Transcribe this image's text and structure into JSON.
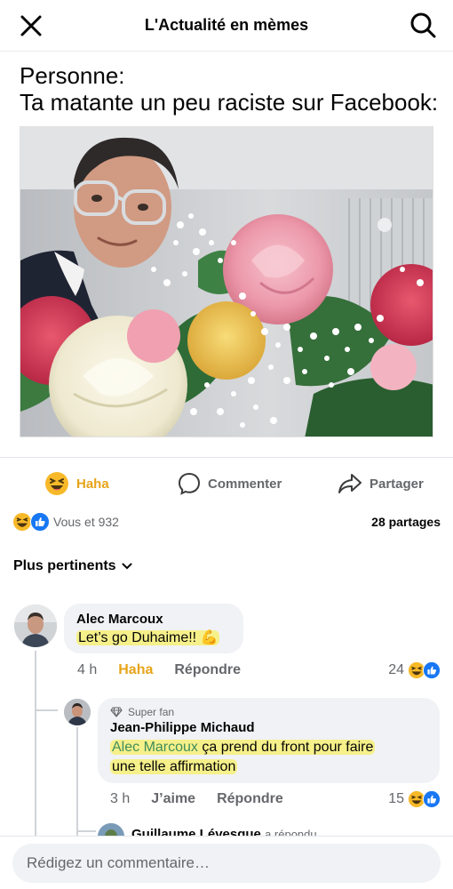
{
  "header": {
    "title": "L'Actualité en mèmes"
  },
  "post": {
    "caption_line1": "Personne:",
    "caption_line2": "Ta matante un peu raciste sur Facebook:"
  },
  "actions": {
    "haha": "Haha",
    "comment": "Commenter",
    "share": "Partager"
  },
  "reactions": {
    "summary": "Vous et 932",
    "shares": "28 partages"
  },
  "sort": {
    "label": "Plus pertinents"
  },
  "comments": [
    {
      "author": "Alec Marcoux",
      "text": "Let’s go Duhaime!! 💪",
      "time": "4 h",
      "reaction_label": "Haha",
      "reply_label": "Répondre",
      "reaction_count": "24"
    },
    {
      "badge": "Super fan",
      "author": "Jean-Philippe Michaud",
      "mention": "Alec Marcoux",
      "text_part1": " ça prend du front pour faire",
      "text_part2": "une telle affirmation",
      "time": "3 h",
      "like_label": "J’aime",
      "reply_label": "Répondre",
      "reaction_count": "15"
    }
  ],
  "partial_reply": {
    "author": "Guillaume Lévesque",
    "suffix": "a répondu"
  },
  "composer": {
    "placeholder": "Rédigez un commentaire…"
  },
  "colors": {
    "haha_yellow": "#f7b928",
    "like_blue": "#1877f2",
    "highlight": "#f6f08a",
    "mention_green": "#3e8e5a"
  }
}
